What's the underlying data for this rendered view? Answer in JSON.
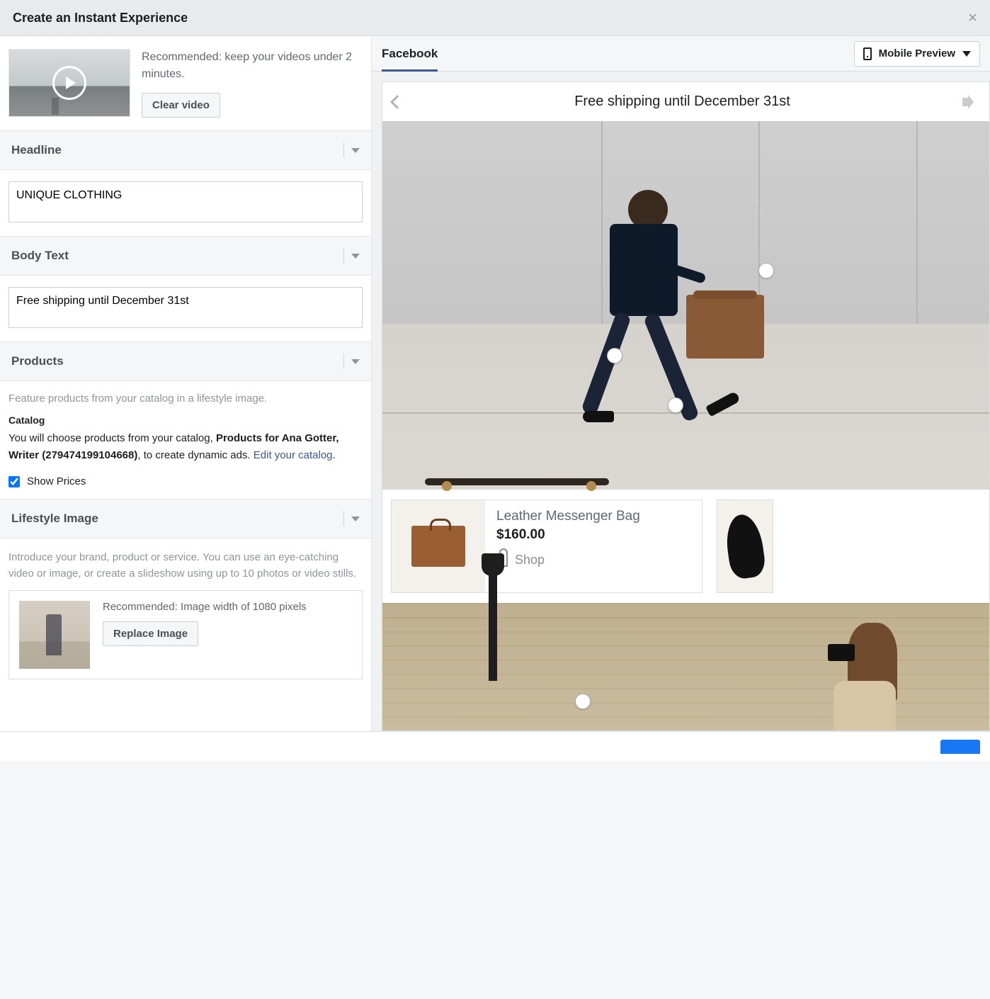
{
  "header": {
    "title": "Create an Instant Experience"
  },
  "video": {
    "recommended": "Recommended: keep your videos under 2 minutes.",
    "clear_button": "Clear video"
  },
  "sections": {
    "headline": {
      "title": "Headline",
      "value": "UNIQUE CLOTHING"
    },
    "body_text": {
      "title": "Body Text",
      "value": "Free shipping until December 31st"
    },
    "products": {
      "title": "Products",
      "helper": "Feature products from your catalog in a lifestyle image.",
      "catalog_label": "Catalog",
      "description_pre": "You will choose products from your catalog, ",
      "description_bold": "Products for Ana Gotter, Writer (279474199104668)",
      "description_post": ", to create dynamic ads. ",
      "edit_link": "Edit your catalog",
      "description_end": ".",
      "show_prices": "Show Prices",
      "show_prices_checked": true
    },
    "lifestyle": {
      "title": "Lifestyle Image",
      "intro": "Introduce your brand, product or service. You can use an eye-catching video or image, or create a slideshow using up to 10 photos or video stills.",
      "recommended": "Recommended: Image width of 1080 pixels",
      "replace_button": "Replace Image"
    }
  },
  "preview": {
    "tab": "Facebook",
    "selector": "Mobile Preview",
    "topbar_title": "Free shipping until December 31st",
    "product": {
      "name": "Leather Messenger Bag",
      "price": "$160.00",
      "shop_label": "Shop"
    }
  }
}
